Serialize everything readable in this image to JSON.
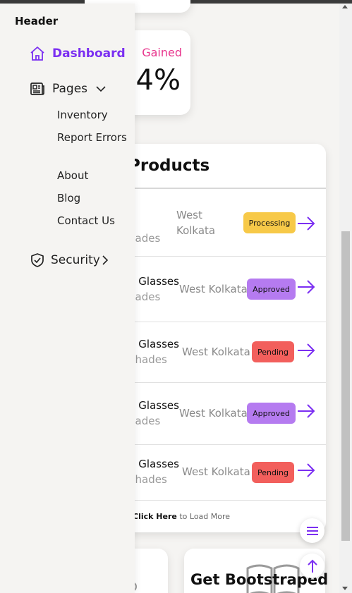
{
  "sidebar": {
    "header": "Header",
    "dashboard_label": "Dashboard",
    "pages_label": "Pages",
    "pages_items": [
      "Inventory",
      "Report Errors",
      "About",
      "Blog",
      "Contact Us"
    ],
    "security_label": "Security"
  },
  "stats": {
    "gained_label": "Gained",
    "gained_value": ".4%"
  },
  "products": {
    "title": "Products",
    "rows": [
      {
        "name": "",
        "sub": "hades",
        "location": "West Kolkata",
        "status": "Processing"
      },
      {
        "name": "n Glasses",
        "sub": "hades",
        "location": "West Kolkata",
        "status": "Approved"
      },
      {
        "name": "n Glasses",
        "sub": "Shades",
        "location": "West Kolkata",
        "status": "Pending"
      },
      {
        "name": "n Glasses",
        "sub": "hades",
        "location": "West Kolkata",
        "status": "Approved"
      },
      {
        "name": "n Glasses",
        "sub": "Shades",
        "location": "West Kolkata",
        "status": "Pending"
      }
    ],
    "load_more_link": "Click Here",
    "load_more_text": " to Load More"
  },
  "promo": {
    "title": "Get Bootstraped"
  },
  "colors": {
    "accent": "#7b2ff2",
    "gained": "#e8358d",
    "processing": "#f7c948",
    "approved": "#b57bf0",
    "pending": "#f25f5c"
  },
  "icons": {
    "dashboard": "home-icon",
    "pages": "newspaper-icon",
    "security": "shield-check-icon",
    "row_action": "arrow-right-icon",
    "fab_menu": "menu-icon",
    "fab_top": "arrow-up-icon"
  }
}
